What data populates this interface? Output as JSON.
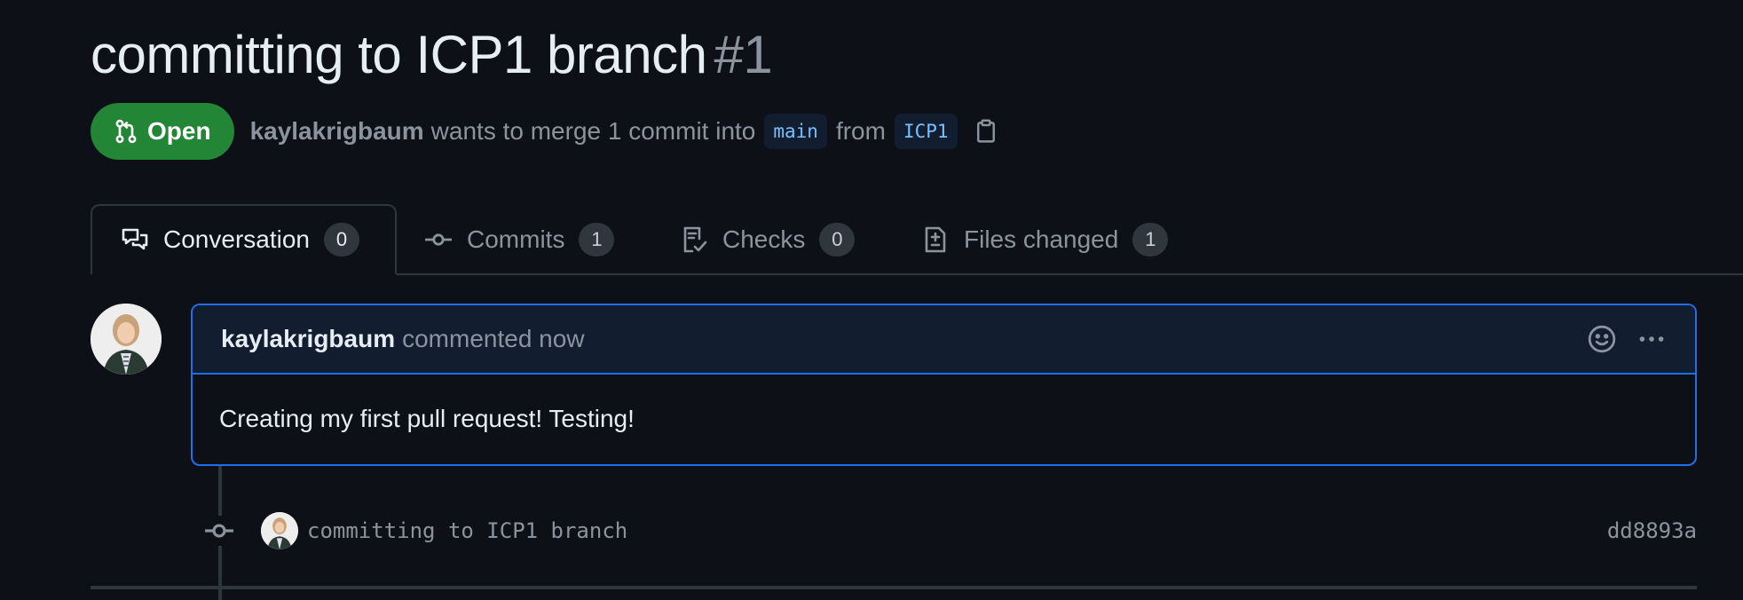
{
  "pull_request": {
    "title": "committing to ICP1 branch",
    "number": "#1",
    "state": "Open",
    "author": "kaylakrigbaum",
    "merge_text": "wants to merge 1 commit into",
    "base_branch": "main",
    "from_text": "from",
    "head_branch": "ICP1"
  },
  "tabs": [
    {
      "label": "Conversation",
      "count": "0",
      "icon": "comment-discussion-icon"
    },
    {
      "label": "Commits",
      "count": "1",
      "icon": "git-commit-icon"
    },
    {
      "label": "Checks",
      "count": "0",
      "icon": "checklist-icon"
    },
    {
      "label": "Files changed",
      "count": "1",
      "icon": "file-diff-icon"
    }
  ],
  "comment": {
    "author": "kaylakrigbaum",
    "when": "commented now",
    "body": "Creating my first pull request! Testing!"
  },
  "commit": {
    "message": "committing to ICP1 branch",
    "sha": "dd8893a"
  },
  "colors": {
    "background": "#0d1117",
    "open_green": "#238636",
    "accent_blue": "#1f6feb",
    "muted": "#8b949e"
  }
}
